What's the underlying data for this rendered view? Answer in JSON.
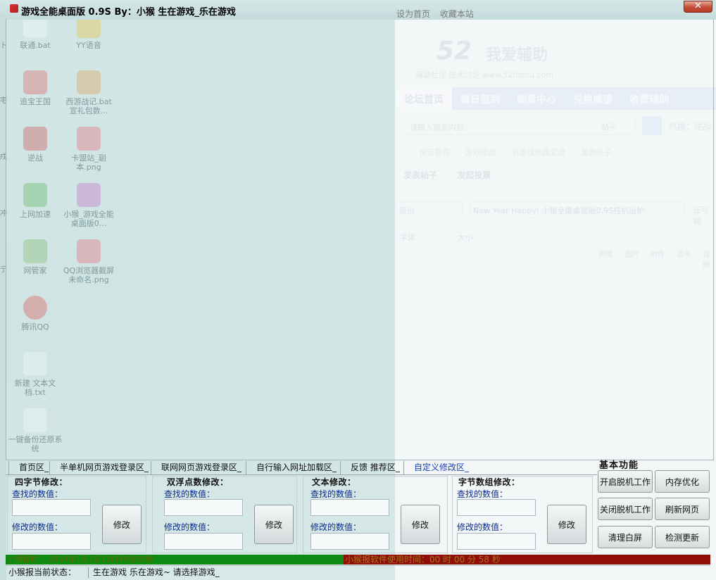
{
  "window": {
    "title": "游戏全能桌面版 0.9S By：小猴   生在游戏_乐在游戏",
    "close_glyph": "✕"
  },
  "desktop_icons": [
    {
      "label": "联通.bat",
      "icon": "bat-file-icon"
    },
    {
      "label": "YY语音",
      "icon": "yy-voice-icon"
    },
    {
      "label": "追宝王国",
      "icon": "treasure-icon"
    },
    {
      "label": "西游战记.bat 宣礼包数...",
      "icon": "bat-file-icon"
    },
    {
      "label": "逆战",
      "icon": "nizhan-icon"
    },
    {
      "label": "卡盟站_副本.png",
      "icon": "png-file-icon"
    },
    {
      "label": "上网加速",
      "icon": "net-speed-icon"
    },
    {
      "label": "小猴_游戏全能桌面版0...",
      "icon": "rar-archive-icon"
    },
    {
      "label": "网管家",
      "icon": "net-manager-icon"
    },
    {
      "label": "QQ浏览器截屏未命名.png",
      "icon": "png-file-icon"
    },
    {
      "label": "腾讯QQ",
      "icon": "qq-penguin-icon"
    },
    {
      "label": "新建 文本文档.txt",
      "icon": "txt-file-icon"
    },
    {
      "label": "一键备份还原系统",
      "icon": "backup-g-icon"
    }
  ],
  "edge_chars": [
    "卜",
    "宅",
    "戍",
    "冲",
    "亍"
  ],
  "web": {
    "top_links": [
      "设为首页",
      "收藏本站"
    ],
    "logo_number": "52",
    "logo_text": "我爱辅助",
    "subtitle": "辅助社区  技术讨论  www.52fuzhu.com",
    "nav": [
      "论坛首页",
      "每日签到",
      "勋章中心",
      "兑换威望",
      "收费辅助"
    ],
    "search_placeholder": "请输入搜索内容",
    "search_scope": "帖子",
    "hot_label": "热搜：",
    "hot_term": "逆战",
    "crumbs": [
      "论坛首页",
      "游戏修改",
      "小游戏修改交流",
      "发表帖子"
    ],
    "post_tabs": [
      "发表帖子",
      "发起投票"
    ],
    "category": "原创",
    "post_title": "New Year Happy!  小猴全能桌面版0.9S挂机出炉",
    "extra_link": "还可输",
    "toolbar_font": "字体",
    "toolbar_size": "大小",
    "toolbar_items": [
      "表情",
      "图片",
      "附件",
      "音乐",
      "视频"
    ]
  },
  "tabs": [
    {
      "label": "首页区_",
      "active": false
    },
    {
      "label": "半单机网页游戏登录区_",
      "active": false
    },
    {
      "label": "联网网页游戏登录区_",
      "active": false
    },
    {
      "label": "自行输入网址加载区_",
      "active": false
    },
    {
      "label": "反馈 推荐区_",
      "active": false
    },
    {
      "label": "自定义修改区_",
      "active": true
    }
  ],
  "groups": [
    {
      "title": "四字节修改：",
      "find_label": "查找的数值：",
      "modify_label": "修改的数值：",
      "find_value": "",
      "modify_value": "",
      "button": "修改"
    },
    {
      "title": "双浮点数修改：",
      "find_label": "查找的数值：",
      "modify_label": "修改的数值：",
      "find_value": "",
      "modify_value": "",
      "button": "修改"
    },
    {
      "title": "文本修改：",
      "find_label": "查找的数值：",
      "modify_label": "修改的数值：",
      "find_value": "",
      "modify_value": "",
      "button": "修改"
    },
    {
      "title": "字节数组修改：",
      "find_label": "查找的数值：",
      "modify_label": "修改的数值：",
      "find_value": "",
      "modify_value": "",
      "button": "修改"
    }
  ],
  "basic": {
    "title": "基本功能",
    "buttons": [
      "开启脱机工作",
      "内存优化",
      "关闭脱机工作",
      "刷新网页",
      "清理白屏",
      "检测更新"
    ]
  },
  "status": {
    "report_time": "小猴报时 ：2014年1月1日11时49分55秒",
    "usage_time": "小猴报软件使用时间：00 时 00 分 58 秒",
    "state_label": "小猴报当前状态：",
    "state_value": "生在游戏 乐在游戏~ 请选择游戏_"
  },
  "colors": {
    "report_bar": "#0d8a14",
    "usage_bar": "#8f0e07",
    "active_tab": "#1a3fb0",
    "field_label": "#0b2b8a"
  }
}
